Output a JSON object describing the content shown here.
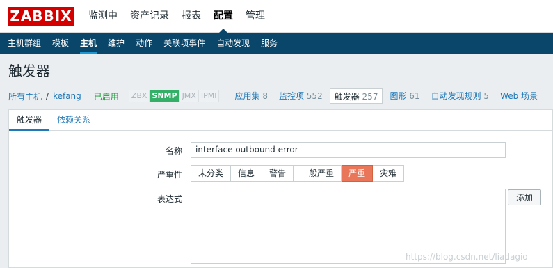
{
  "app": {
    "logo": "ZABBIX"
  },
  "main_menu": [
    {
      "label": "监测中",
      "active": false
    },
    {
      "label": "资产记录",
      "active": false
    },
    {
      "label": "报表",
      "active": false
    },
    {
      "label": "配置",
      "active": true
    },
    {
      "label": "管理",
      "active": false
    }
  ],
  "sub_menu": [
    {
      "label": "主机群组",
      "active": false
    },
    {
      "label": "模板",
      "active": false
    },
    {
      "label": "主机",
      "active": true
    },
    {
      "label": "维护",
      "active": false
    },
    {
      "label": "动作",
      "active": false
    },
    {
      "label": "关联项事件",
      "active": false
    },
    {
      "label": "自动发现",
      "active": false
    },
    {
      "label": "服务",
      "active": false
    }
  ],
  "page": {
    "title": "触发器"
  },
  "host_nav": {
    "all_hosts": "所有主机",
    "separator": "/",
    "host": "kefang",
    "status": "已启用",
    "availability": [
      {
        "label": "ZBX",
        "on": false
      },
      {
        "label": "SNMP",
        "on": true
      },
      {
        "label": "JMX",
        "on": false
      },
      {
        "label": "IPMI",
        "on": false
      }
    ],
    "tabs": [
      {
        "label": "应用集",
        "count": "8",
        "selected": false
      },
      {
        "label": "监控项",
        "count": "552",
        "selected": false
      },
      {
        "label": "触发器",
        "count": "257",
        "selected": true
      },
      {
        "label": "图形",
        "count": "61",
        "selected": false
      },
      {
        "label": "自动发现规则",
        "count": "5",
        "selected": false
      },
      {
        "label": "Web 场景",
        "count": "",
        "selected": false
      }
    ]
  },
  "form": {
    "tabs": [
      {
        "label": "触发器",
        "selected": true
      },
      {
        "label": "依赖关系",
        "selected": false
      }
    ],
    "name_label": "名称",
    "name_value": "interface  outbound error",
    "severity_label": "严重性",
    "severity_options": [
      {
        "label": "未分类",
        "selected": false
      },
      {
        "label": "信息",
        "selected": false
      },
      {
        "label": "警告",
        "selected": false
      },
      {
        "label": "一般严重",
        "selected": false
      },
      {
        "label": "严重",
        "selected": true
      },
      {
        "label": "灾难",
        "selected": false
      }
    ],
    "expression_label": "表达式",
    "expression_value": "",
    "add_button": "添加"
  },
  "watermark": "https://blog.csdn.net/liadagio",
  "colors": {
    "logo_red": "#d40000",
    "subnav_bg": "#0a466a",
    "link": "#1f78b8",
    "enabled_green": "#1e9f3c",
    "snmp_on": "#34af67",
    "severity_high": "#e97659"
  }
}
